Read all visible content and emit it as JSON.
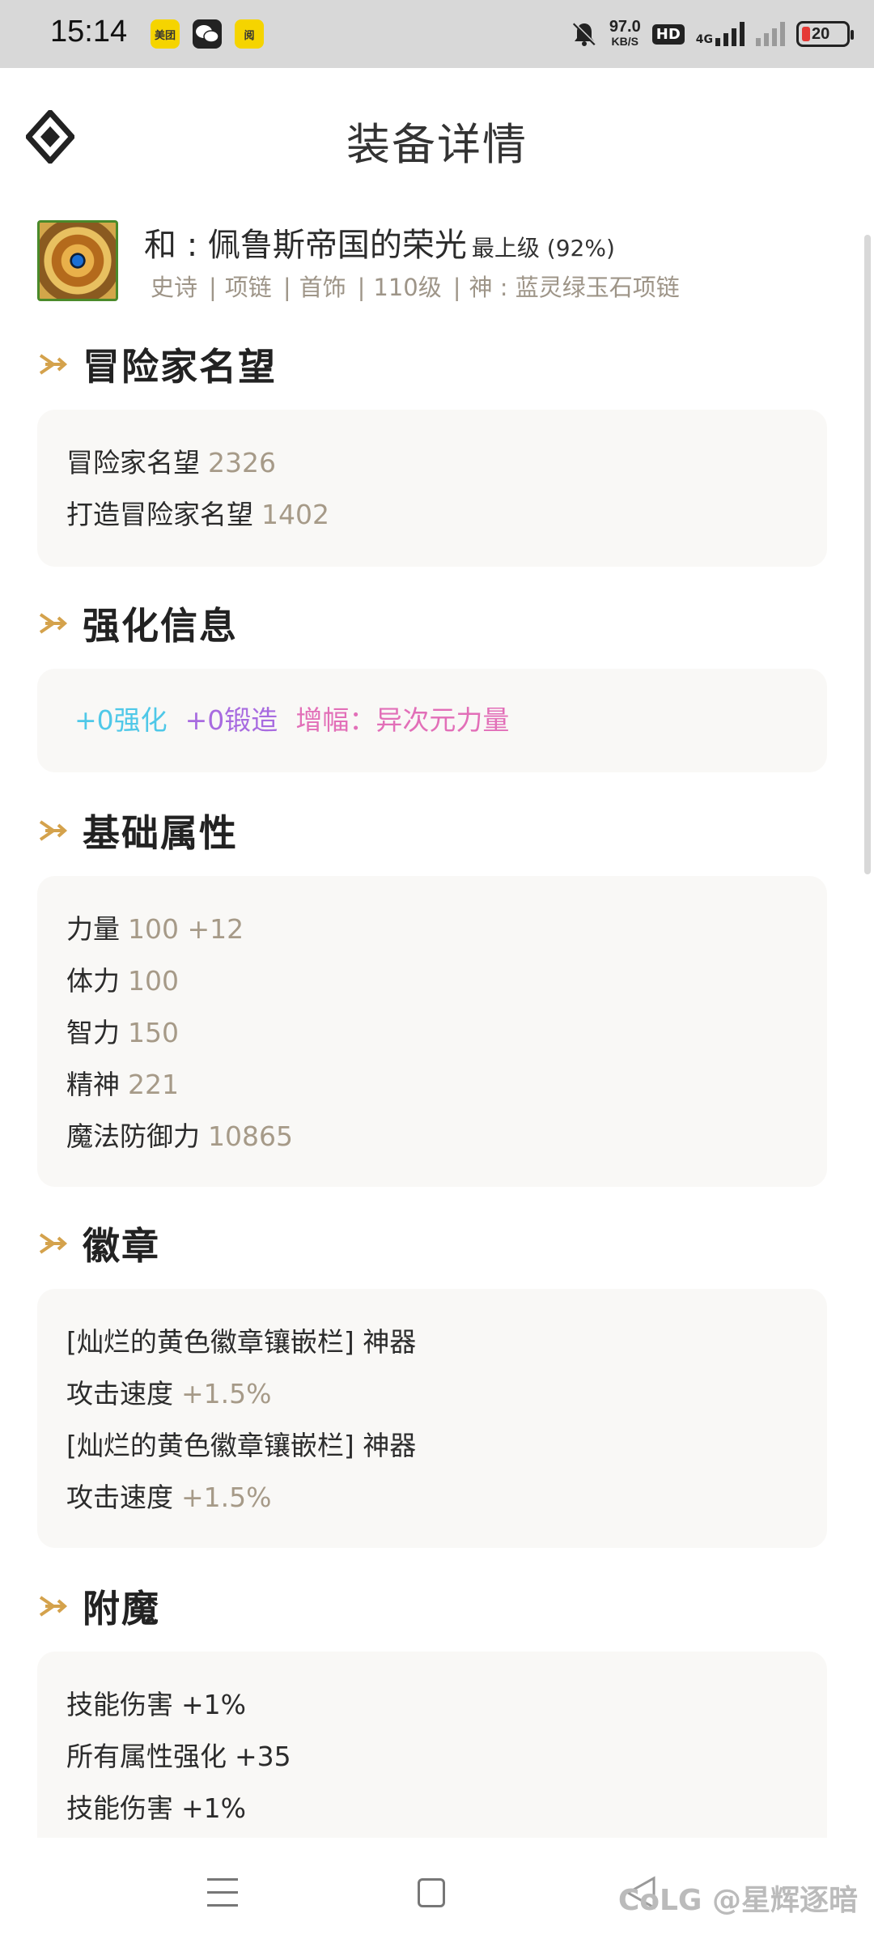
{
  "status_bar": {
    "time": "15:14",
    "app_icons": [
      "美团",
      "微信",
      "阅"
    ],
    "net_speed": "97.0",
    "net_unit": "KB/S",
    "hd": "HD",
    "signal": "4G",
    "battery": "20"
  },
  "header": {
    "title": "装备详情"
  },
  "item": {
    "name": "和 : 佩鲁斯帝国的荣光",
    "grade": "最上级 (92%)",
    "tags": [
      "史诗",
      "项链",
      "首饰",
      "110级",
      "神 : 蓝灵绿玉石项链"
    ]
  },
  "sections": {
    "fame": {
      "title": "冒险家名望",
      "rows": [
        {
          "label": "冒险家名望",
          "value": "2326"
        },
        {
          "label": "打造冒险家名望",
          "value": "1402"
        }
      ]
    },
    "enhance": {
      "title": "强化信息",
      "reinforce": "+0强化",
      "forge": "+0锻造",
      "amplify": "增幅：异次元力量"
    },
    "base": {
      "title": "基础属性",
      "rows": [
        {
          "label": "力量",
          "value": "100 +12"
        },
        {
          "label": "体力",
          "value": "100"
        },
        {
          "label": "智力",
          "value": "150"
        },
        {
          "label": "精神",
          "value": "221"
        },
        {
          "label": "魔法防御力",
          "value": "10865"
        }
      ]
    },
    "emblem": {
      "title": "徽章",
      "rows": [
        {
          "label": "[灿烂的黄色徽章镶嵌栏] 神器",
          "value": ""
        },
        {
          "label": "攻击速度",
          "value": "+1.5%"
        },
        {
          "label": "[灿烂的黄色徽章镶嵌栏] 神器",
          "value": ""
        },
        {
          "label": "攻击速度",
          "value": "+1.5%"
        }
      ]
    },
    "enchant": {
      "title": "附魔",
      "rows": [
        {
          "label": "技能伤害",
          "value": "+1%"
        },
        {
          "label": "所有属性强化",
          "value": "+35"
        },
        {
          "label": "技能伤害",
          "value": "+1%"
        }
      ]
    }
  },
  "watermark": "CoLG @星辉逐暗",
  "colors": {
    "accent": "#d4a24c",
    "value": "#a69a88",
    "card": "#f9f8f6"
  }
}
